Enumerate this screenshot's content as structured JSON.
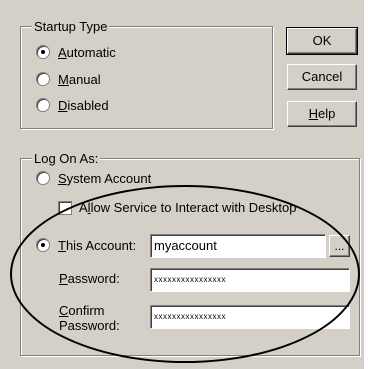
{
  "startup": {
    "legend": "Startup Type",
    "options": [
      {
        "mnemonic": "A",
        "rest": "utomatic",
        "checked": true
      },
      {
        "mnemonic": "M",
        "rest": "anual",
        "checked": false
      },
      {
        "mnemonic": "D",
        "rest": "isabled",
        "checked": false
      }
    ]
  },
  "buttons": {
    "ok": "OK",
    "cancel": "Cancel",
    "help_mnemonic": "H",
    "help_rest": "elp"
  },
  "logon": {
    "legend": "Log On As:",
    "system_account_mnemonic": "S",
    "system_account_rest": "ystem Account",
    "interact_pre": "A",
    "interact_mnemonic": "l",
    "interact_rest": "low Service to Interact with Desktop",
    "this_account_mnemonic": "T",
    "this_account_rest": "his Account:",
    "account_value": "myaccount",
    "browse_label": "...",
    "password_mnemonic": "P",
    "password_rest": "assword:",
    "password_value": "xxxxxxxxxxxxxxxx",
    "confirm_mnemonic": "C",
    "confirm_rest": "onfirm",
    "confirm_line2": "Password:",
    "confirm_value": "xxxxxxxxxxxxxxxx",
    "system_account_checked": false,
    "this_account_checked": true,
    "interact_checked": false
  }
}
